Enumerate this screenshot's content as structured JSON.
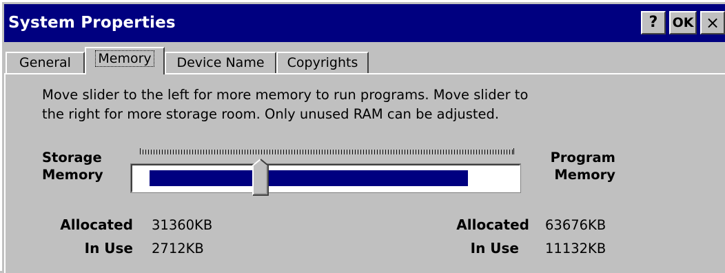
{
  "window": {
    "title": "System Properties",
    "help_label": "?",
    "ok_label": "OK",
    "close_label": "×"
  },
  "tabs": [
    {
      "label": "General",
      "selected": false
    },
    {
      "label": "Memory",
      "selected": true
    },
    {
      "label": "Device Name",
      "selected": false
    },
    {
      "label": "Copyrights",
      "selected": false
    }
  ],
  "memory": {
    "description_line1": "Move slider to the left for more memory to run programs. Move slider to",
    "description_line2": "the right for more storage room. Only unused RAM can be adjusted.",
    "storage_label_line1": "Storage",
    "storage_label_line2": "Memory",
    "program_label_line1": "Program",
    "program_label_line2": "Memory",
    "slider_position": 0.33,
    "storage": {
      "allocated_label": "Allocated",
      "allocated_value": "31360KB",
      "inuse_label": "In Use",
      "inuse_value": "2712KB"
    },
    "program": {
      "allocated_label": "Allocated",
      "allocated_value": "63676KB",
      "inuse_label": "In Use",
      "inuse_value": "11132KB"
    }
  },
  "colors": {
    "titlebar": "#000080",
    "face": "#c0c0c0",
    "fill": "#000080"
  }
}
